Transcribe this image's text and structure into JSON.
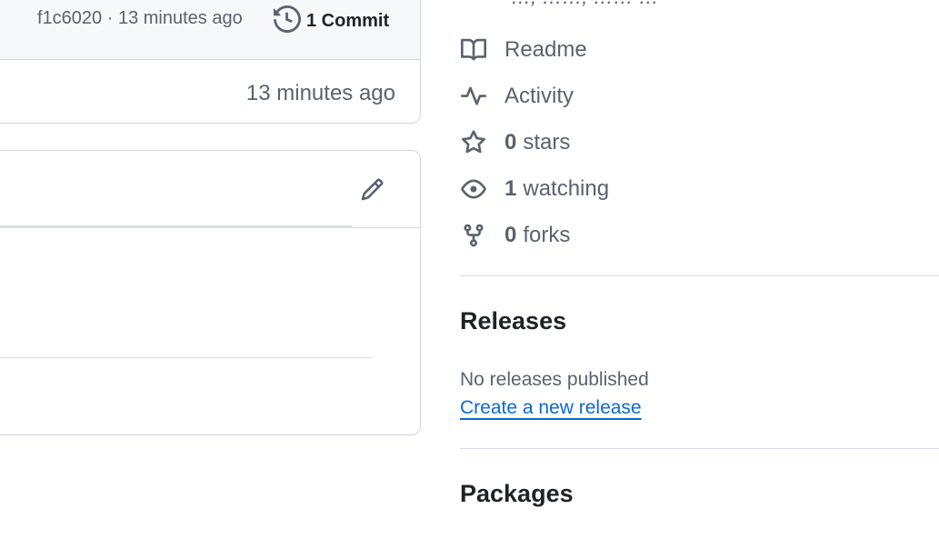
{
  "latest_commit": {
    "sha_and_time": "f1c6020 · 13 minutes ago",
    "commits_label": "1 Commit"
  },
  "file_row": {
    "time": "13 minutes ago"
  },
  "about": {
    "clipped_description": "…, ……, …… …"
  },
  "sidebar": {
    "readme": "Readme",
    "activity": "Activity",
    "stars": {
      "count": "0",
      "label": "stars"
    },
    "watching": {
      "count": "1",
      "label": "watching"
    },
    "forks": {
      "count": "0",
      "label": "forks"
    }
  },
  "releases": {
    "title": "Releases",
    "empty_text": "No releases published",
    "create_link": "Create a new release"
  },
  "packages": {
    "title": "Packages"
  },
  "colors": {
    "muted_text": "#59636e",
    "link": "#0969da",
    "border": "#d0d7de",
    "header_bg": "#f6f8fa"
  },
  "icons": [
    "history-icon",
    "pencil-icon",
    "book-icon",
    "pulse-icon",
    "star-icon",
    "eye-icon",
    "repo-forked-icon"
  ]
}
